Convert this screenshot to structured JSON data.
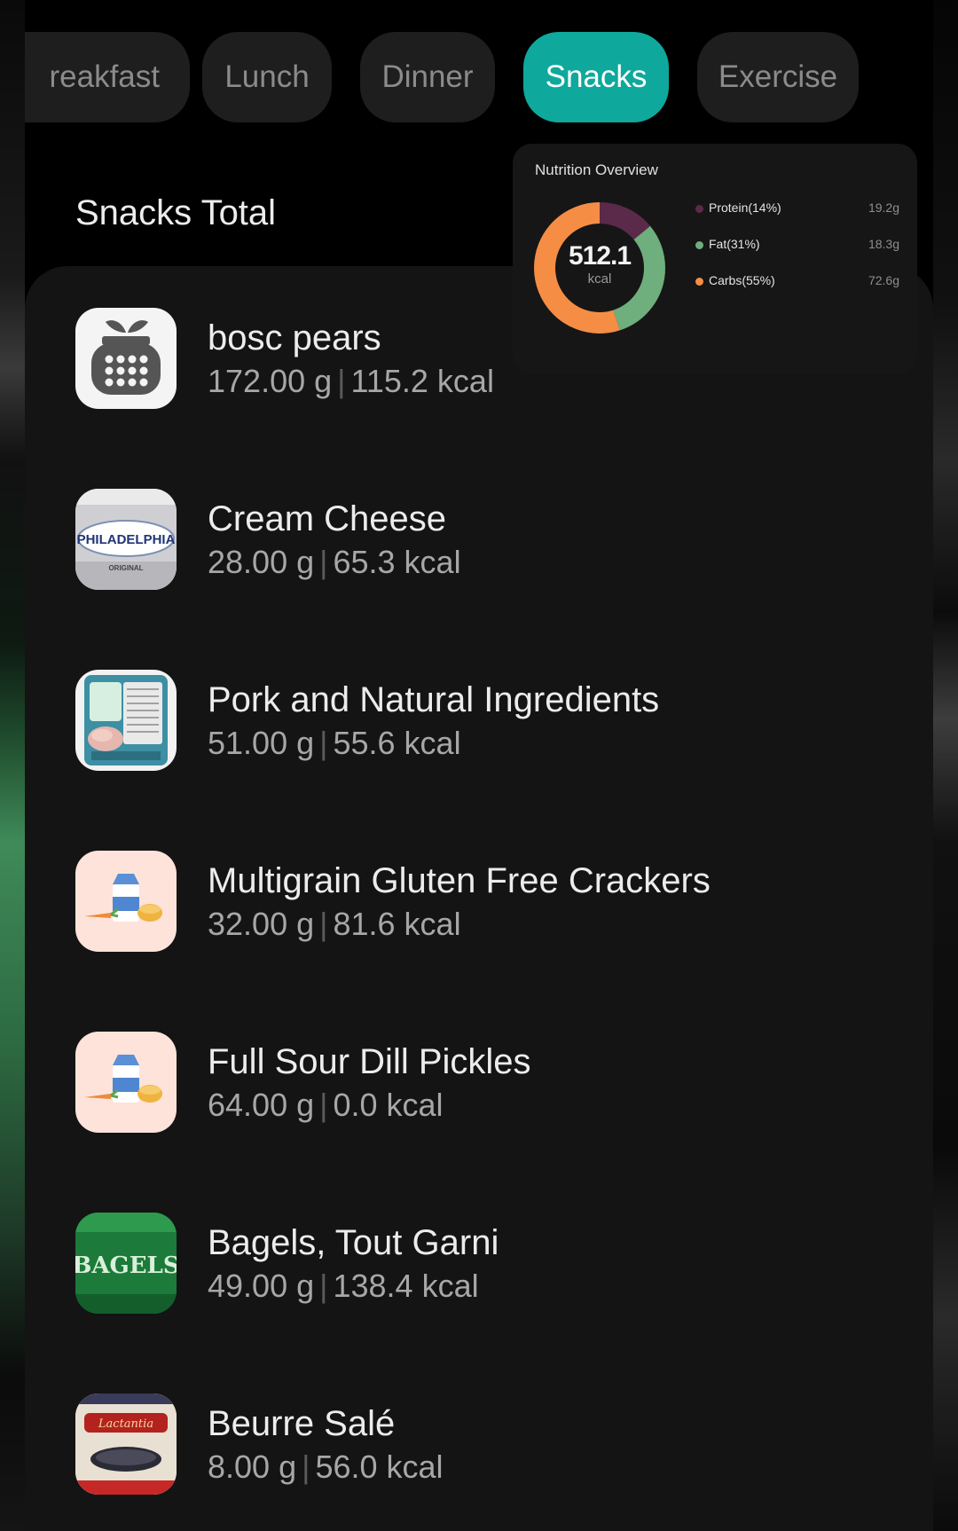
{
  "tabs": [
    {
      "label": "reakfast",
      "active": false
    },
    {
      "label": "Lunch",
      "active": false
    },
    {
      "label": "Dinner",
      "active": false
    },
    {
      "label": "Snacks",
      "active": true
    },
    {
      "label": "Exercise",
      "active": false
    }
  ],
  "section_title": "Snacks Total",
  "overview": {
    "title": "Nutrition Overview",
    "kcal_value": "512.1",
    "kcal_unit": "kcal",
    "legend": [
      {
        "label": "Protein(14%)",
        "value": "19.2g",
        "percent": 14,
        "color": "#5b2a4a"
      },
      {
        "label": "Fat(31%)",
        "value": "18.3g",
        "percent": 31,
        "color": "#6fae7d"
      },
      {
        "label": "Carbs(55%)",
        "value": "72.6g",
        "percent": 55,
        "color": "#f68d45"
      }
    ]
  },
  "items": [
    {
      "name": "bosc pears",
      "grams": "172.00 g",
      "kcal": "115.2 kcal",
      "icon": "calculator-apple-icon"
    },
    {
      "name": "Cream Cheese",
      "grams": "28.00 g",
      "kcal": "65.3 kcal",
      "icon": "philadelphia-cream-cheese-thumbnail",
      "logo_text": "PHILADELPHIA",
      "logo_sub": "ORIGINAL"
    },
    {
      "name": "Pork and Natural Ingredients",
      "grams": "51.00 g",
      "kcal": "55.6 kcal",
      "icon": "packaged-pork-thumbnail"
    },
    {
      "name": "Multigrain Gluten Free Crackers",
      "grams": "32.00 g",
      "kcal": "81.6 kcal",
      "icon": "generic-food-icon"
    },
    {
      "name": "Full Sour Dill Pickles",
      "grams": "64.00 g",
      "kcal": "0.0 kcal",
      "icon": "generic-food-icon"
    },
    {
      "name": "Bagels, Tout Garni",
      "grams": "49.00 g",
      "kcal": "138.4 kcal",
      "icon": "bagels-bag-thumbnail",
      "logo_text": "BAGELS"
    },
    {
      "name": "Beurre Salé",
      "grams": "8.00 g",
      "kcal": "56.0 kcal",
      "icon": "beurre-package-thumbnail",
      "logo_text": "Lactantia"
    }
  ],
  "separator": "|"
}
